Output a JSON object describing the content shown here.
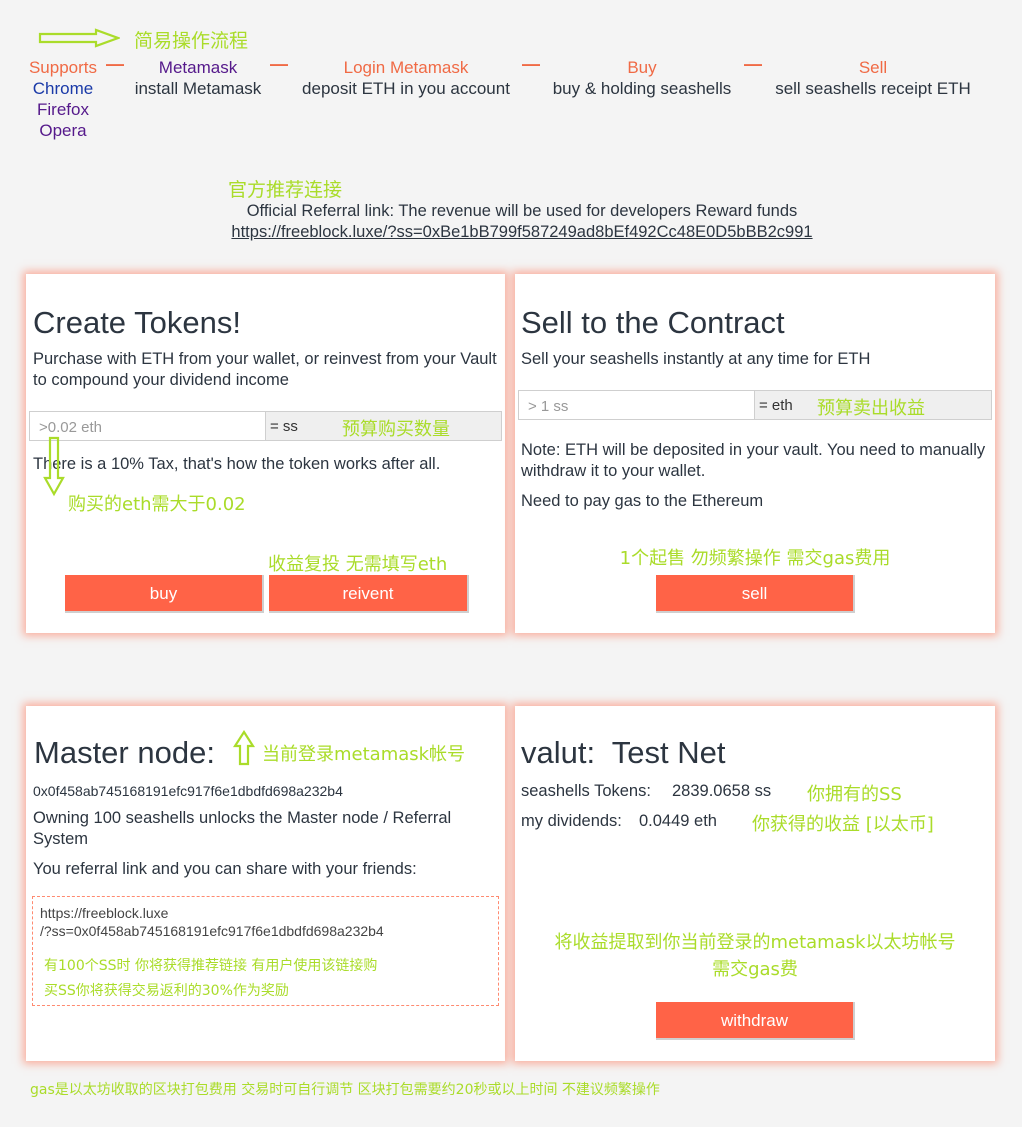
{
  "header": {
    "flow_title": "简易操作流程",
    "steps": [
      {
        "title": "Supports",
        "browsers": [
          "Chrome",
          "Firefox",
          "Opera"
        ]
      },
      {
        "title": "Metamask",
        "desc": "install Metamask"
      },
      {
        "title": "Login Metamask",
        "desc": "deposit ETH in you account"
      },
      {
        "title": "Buy",
        "desc": "buy & holding seashells"
      },
      {
        "title": "Sell",
        "desc": "sell seashells receipt ETH"
      }
    ],
    "separator": "—"
  },
  "referral": {
    "title_cn": "官方推荐连接",
    "description": "Official Referral link: The revenue will be used for developers Reward funds",
    "link": "https://freeblock.luxe/?ss=0xBe1bB799f587249ad8bEf492Cc48E0D5bBB2c991"
  },
  "create": {
    "title": "Create Tokens!",
    "subtitle": "Purchase with ETH from your wallet, or reinvest from your Vault to compound your dividend income",
    "input_placeholder": ">0.02 eth",
    "addon": "= ss",
    "hint_estimate": "预算购买数量",
    "tax_note": "There is a 10% Tax, that's how the token works after all.",
    "hint_min": "购买的eth需大于0.02",
    "hint_reinvest": "收益复投 无需填写eth",
    "buy_label": "buy",
    "reinvest_label": "reivent"
  },
  "sell": {
    "title": "Sell to the Contract",
    "subtitle": "Sell your seashells instantly at any time for ETH",
    "input_placeholder": "> 1 ss",
    "addon": "= eth",
    "hint_estimate": "预算卖出收益",
    "note": "Note: ETH will be deposited in your vault. You need to manually withdraw it to your wallet.",
    "gas_note": "Need to pay gas to the Ethereum",
    "hint_sell": "1个起售 勿频繁操作 需交gas费用",
    "sell_label": "sell"
  },
  "master": {
    "title": "Master node:",
    "hint_login": "当前登录metamask帐号",
    "address": "0x0f458ab745168191efc917f6e1dbdfd698a232b4",
    "owning_note": "Owning 100 seashells unlocks the Master node / Referral System",
    "share_note": "You referral link and you can share with your friends:",
    "ref_link_1": "https://freeblock.luxe",
    "ref_link_2": "/?ss=0x0f458ab745168191efc917f6e1dbdfd698a232b4",
    "ref_hint_1": "有100个SS时 你将获得推荐链接 有用户使用该链接购",
    "ref_hint_2": "买SS你将获得交易返利的30%作为奖励"
  },
  "vault": {
    "title": "valut:  Test Net",
    "tokens_label": "seashells Tokens:",
    "tokens_value": "2839.0658 ss",
    "tokens_hint": "你拥有的SS",
    "dividends_label": "my dividends:",
    "dividends_value": "0.0449 eth",
    "dividends_hint": "你获得的收益 [以太币]",
    "withdraw_hint_1": "将收益提取到你当前登录的metamask以太坊帐号",
    "withdraw_hint_2": "需交gas费",
    "withdraw_label": "withdraw"
  },
  "footer": {
    "gas_note": "gas是以太坊收取的区块打包费用 交易时可自行调节 区块打包需要约20秒或以上时间 不建议频繁操作"
  },
  "colors": {
    "accent": "#ff6347",
    "hint": "#aadc2a",
    "purple": "#55198b",
    "orange": "#f06a45"
  }
}
